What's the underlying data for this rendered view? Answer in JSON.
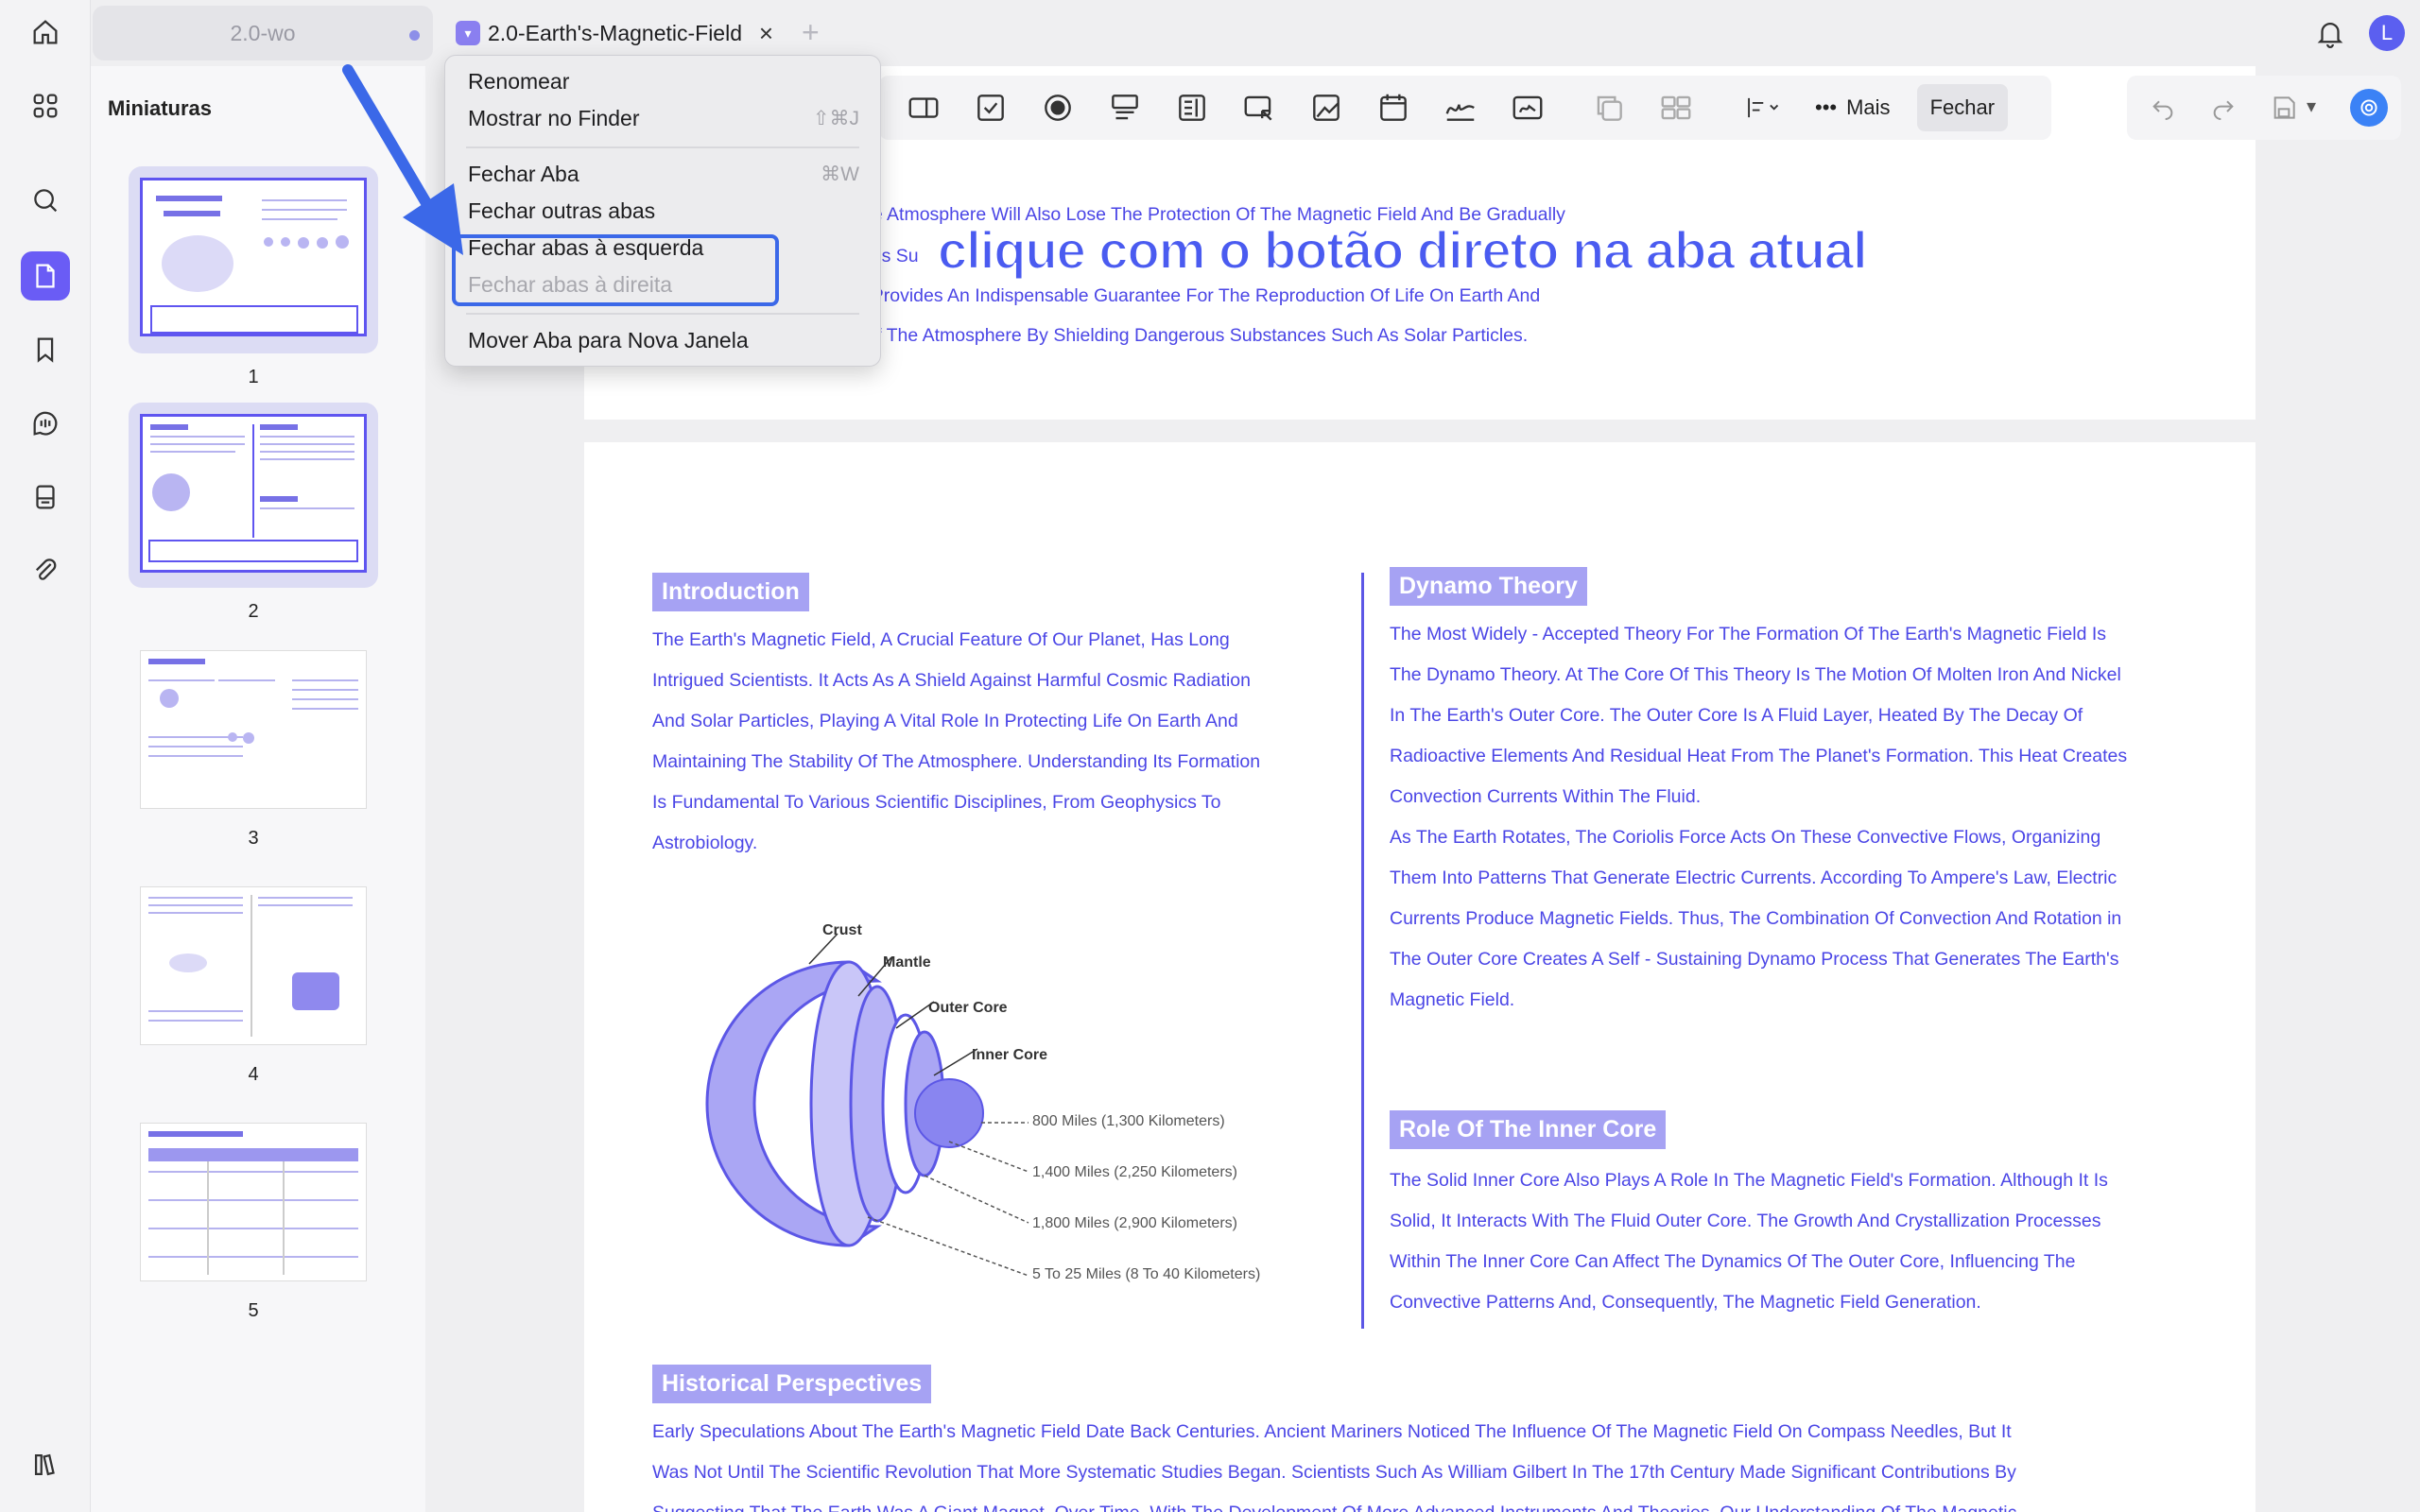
{
  "tabs": {
    "inactive_label": "2.0-wo",
    "active_label": "2.0-Earth's-Magnetic-Field",
    "close_glyph": "×",
    "add_glyph": "+"
  },
  "user": {
    "avatar_initial": "L"
  },
  "sidebar": {
    "title": "Miniaturas",
    "pages": [
      {
        "num": "1",
        "selected": true
      },
      {
        "num": "2",
        "selected": true
      },
      {
        "num": "3",
        "selected": false
      },
      {
        "num": "4",
        "selected": false
      },
      {
        "num": "5",
        "selected": false
      }
    ]
  },
  "context_menu": {
    "items": [
      {
        "label": "Renomear",
        "shortcut": "",
        "enabled": true
      },
      {
        "label": "Mostrar no Finder",
        "shortcut": "⇧⌘J",
        "enabled": true
      },
      {
        "label": "Fechar Aba",
        "shortcut": "⌘W",
        "enabled": true
      },
      {
        "label": "Fechar outras abas",
        "shortcut": "",
        "enabled": true
      },
      {
        "label": "Fechar abas à esquerda",
        "shortcut": "",
        "enabled": true
      },
      {
        "label": "Fechar abas à direita",
        "shortcut": "",
        "enabled": false
      },
      {
        "label": "Mover Aba para Nova Janela",
        "shortcut": "",
        "enabled": true
      }
    ]
  },
  "toolbar": {
    "more_label": "Mais",
    "close_label": "Fechar"
  },
  "annotation": "clique com o botão direto na aba atual",
  "document": {
    "top_lines": [
      "he Atmosphere Will Also Lose The Protection Of The Magnetic Field And Be Gradually",
      "ces Su",
      "l Provides An Indispensable Guarantee For The Reproduction Of Life On Earth And",
      "Of The Atmosphere By Shielding Dangerous Substances Such As Solar Particles."
    ],
    "intro": {
      "heading": "Introduction",
      "lines": [
        "The Earth's Magnetic Field, A Crucial Feature Of Our Planet, Has Long",
        "Intrigued Scientists. It Acts As A Shield Against Harmful Cosmic Radiation",
        "And Solar Particles, Playing A Vital Role In Protecting Life On Earth And",
        "Maintaining The Stability Of The Atmosphere. Understanding Its Formation",
        "Is Fundamental To Various Scientific Disciplines, From Geophysics To",
        "Astrobiology."
      ]
    },
    "diagram": {
      "labels": {
        "crust": "Crust",
        "mantle": "Mantle",
        "outer_core": "Outer Core",
        "inner_core": "Inner Core"
      },
      "distances": [
        "800 Miles (1,300 Kilometers)",
        "1,400 Miles (2,250 Kilometers)",
        "1,800 Miles (2,900 Kilometers)",
        "5 To 25 Miles (8 To 40 Kilometers)"
      ]
    },
    "dynamo": {
      "heading": "Dynamo Theory",
      "lines": [
        "The Most Widely - Accepted Theory For The Formation Of The Earth's Magnetic Field Is",
        "The Dynamo Theory. At The Core Of This Theory Is The Motion Of Molten Iron And Nickel",
        "In The Earth's Outer Core. The Outer Core Is A Fluid Layer, Heated By The Decay Of",
        "Radioactive Elements And Residual Heat From The Planet's Formation. This Heat Creates",
        "Convection Currents Within The Fluid.",
        "As The Earth Rotates, The Coriolis Force Acts On These Convective Flows, Organizing",
        "Them Into Patterns That Generate Electric Currents. According To Ampere's Law, Electric",
        "Currents Produce Magnetic Fields. Thus, The Combination Of Convection And Rotation in",
        "The Outer Core Creates A Self - Sustaining Dynamo Process That Generates The Earth's",
        "Magnetic Field."
      ]
    },
    "inner_core": {
      "heading": "Role Of The Inner Core",
      "lines": [
        "The Solid Inner Core Also Plays A Role In The Magnetic Field's Formation. Although It Is",
        "Solid, It Interacts With The Fluid Outer Core. The Growth And Crystallization Processes",
        "Within The Inner Core Can Affect The Dynamics Of The Outer Core, Influencing The",
        "Convective Patterns And, Consequently, The Magnetic Field Generation."
      ]
    },
    "historical": {
      "heading": "Historical Perspectives",
      "lines": [
        "Early Speculations About The Earth's Magnetic Field Date Back Centuries. Ancient Mariners Noticed The Influence Of The Magnetic Field On Compass Needles, But It",
        "Was Not Until The Scientific Revolution That More Systematic Studies Began. Scientists Such As William Gilbert In The 17th Century Made Significant Contributions By",
        "Suggesting That The Earth Was A Giant Magnet. Over Time, With The Development Of More Advanced Instruments And Theories, Our Understanding Of The Magnetic"
      ]
    }
  },
  "colors": {
    "accent": "#6a5cf5",
    "text_blue": "#4b46e6",
    "tag_bg": "#a6a2f3",
    "highlight": "#3b68e8"
  }
}
